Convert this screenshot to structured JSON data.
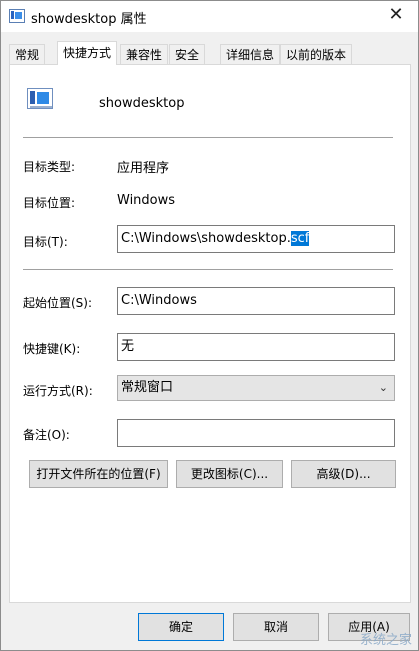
{
  "window": {
    "title": "showdesktop 属性",
    "close_icon": "close-icon"
  },
  "tabs": [
    {
      "label": "常规",
      "active": false
    },
    {
      "label": "快捷方式",
      "active": true
    },
    {
      "label": "兼容性",
      "active": false
    },
    {
      "label": "安全",
      "active": false
    },
    {
      "label": "详细信息",
      "active": false
    },
    {
      "label": "以前的版本",
      "active": false
    }
  ],
  "shortcut": {
    "name": "showdesktop",
    "target_type_label": "目标类型:",
    "target_type_value": "应用程序",
    "target_location_label": "目标位置:",
    "target_location_value": "Windows",
    "target_label": "目标(T):",
    "target_value_unselected": "C:\\Windows\\showdesktop.",
    "target_value_selected": "scf",
    "start_in_label": "起始位置(S):",
    "start_in_value": "C:\\Windows",
    "hotkey_label": "快捷键(K):",
    "hotkey_value": "无",
    "run_label": "运行方式(R):",
    "run_value": "常规窗口",
    "comment_label": "备注(O):",
    "comment_value": ""
  },
  "action_buttons": {
    "open_location": "打开文件所在的位置(F)",
    "change_icon": "更改图标(C)...",
    "advanced": "高级(D)..."
  },
  "footer": {
    "ok": "确定",
    "cancel": "取消",
    "apply": "应用(A)"
  },
  "watermark": "系统之家",
  "colors": {
    "selection": "#0078d7",
    "accent": "#0078d7"
  }
}
